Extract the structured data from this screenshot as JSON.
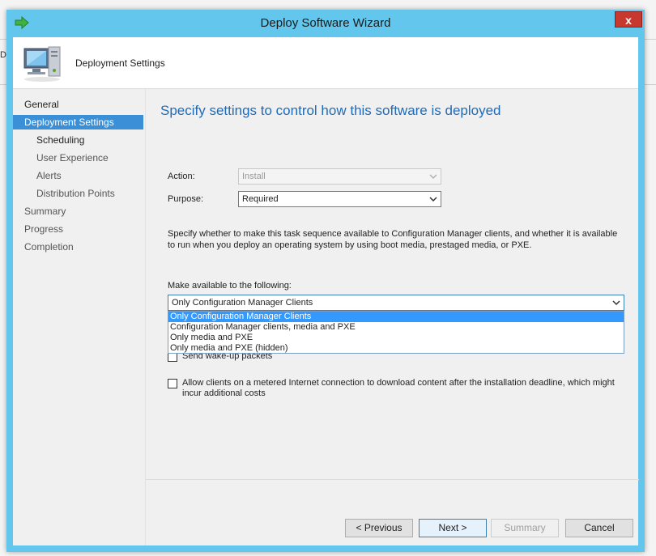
{
  "window": {
    "title": "Deploy Software Wizard",
    "close_label": "x",
    "background_fragment": "De"
  },
  "header": {
    "title": "Deployment Settings"
  },
  "nav": {
    "items": [
      {
        "label": "General",
        "state": "done"
      },
      {
        "label": "Deployment Settings",
        "state": "current"
      },
      {
        "label": "Scheduling",
        "state": "done"
      },
      {
        "label": "User Experience",
        "state": "pending"
      },
      {
        "label": "Alerts",
        "state": "pending"
      },
      {
        "label": "Distribution Points",
        "state": "pending"
      },
      {
        "label": "Summary",
        "state": "pending"
      },
      {
        "label": "Progress",
        "state": "pending"
      },
      {
        "label": "Completion",
        "state": "pending"
      }
    ]
  },
  "main": {
    "heading": "Specify settings to control how this software is deployed",
    "action_label": "Action:",
    "action_value": "Install",
    "purpose_label": "Purpose:",
    "purpose_value": "Required",
    "description": "Specify whether to make this task sequence available to Configuration Manager clients, and whether it is available to run when you deploy an operating system by using boot media, prestaged media, or PXE.",
    "make_available_label": "Make available to the following:",
    "make_available_value": "Only Configuration Manager Clients",
    "options": [
      "Only Configuration Manager Clients",
      "Configuration Manager clients, media and PXE",
      "Only media and PXE",
      "Only media and PXE (hidden)"
    ],
    "wakeup_label": "Send wake-up packets",
    "metered_label": "Allow clients on a metered Internet connection to download content after the installation deadline, which might incur additional costs"
  },
  "buttons": {
    "previous": "< Previous",
    "next": "Next >",
    "summary": "Summary",
    "cancel": "Cancel"
  },
  "colors": {
    "titlebar": "#63c6ec",
    "selection": "#3b8fd6",
    "heading": "#1e6bb8",
    "close": "#c7392f"
  }
}
